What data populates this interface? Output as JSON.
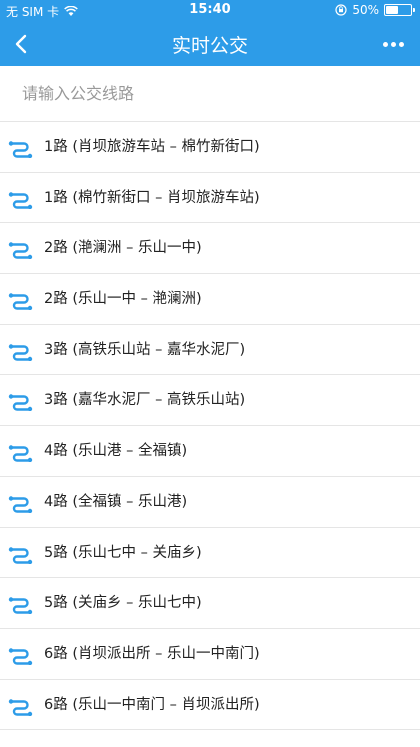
{
  "status_bar": {
    "carrier": "无 SIM 卡",
    "time": "15:40",
    "battery": "50%",
    "battery_level": 0.5
  },
  "nav": {
    "title": "实时公交"
  },
  "search": {
    "placeholder": "请输入公交线路",
    "value": ""
  },
  "colors": {
    "accent": "#2d9ce8",
    "icon": "#2d9ce8"
  },
  "icons": {
    "route": "bus-route-icon",
    "back": "chevron-left-icon",
    "more": "more-dots-icon",
    "wifi": "wifi-icon",
    "lock": "rotation-lock-icon"
  },
  "routes": [
    {
      "label": "1路 (肖坝旅游车站 – 棉竹新街口)"
    },
    {
      "label": "1路 (棉竹新街口 – 肖坝旅游车站)"
    },
    {
      "label": "2路 (滟澜洲 – 乐山一中)"
    },
    {
      "label": "2路 (乐山一中 – 滟澜洲)"
    },
    {
      "label": "3路 (高铁乐山站 – 嘉华水泥厂)"
    },
    {
      "label": "3路 (嘉华水泥厂 – 高铁乐山站)"
    },
    {
      "label": "4路 (乐山港 – 全福镇)"
    },
    {
      "label": "4路 (全福镇 – 乐山港)"
    },
    {
      "label": "5路 (乐山七中 – 关庙乡)"
    },
    {
      "label": "5路 (关庙乡 – 乐山七中)"
    },
    {
      "label": "6路 (肖坝派出所 – 乐山一中南门)"
    },
    {
      "label": "6路 (乐山一中南门 – 肖坝派出所)"
    }
  ]
}
